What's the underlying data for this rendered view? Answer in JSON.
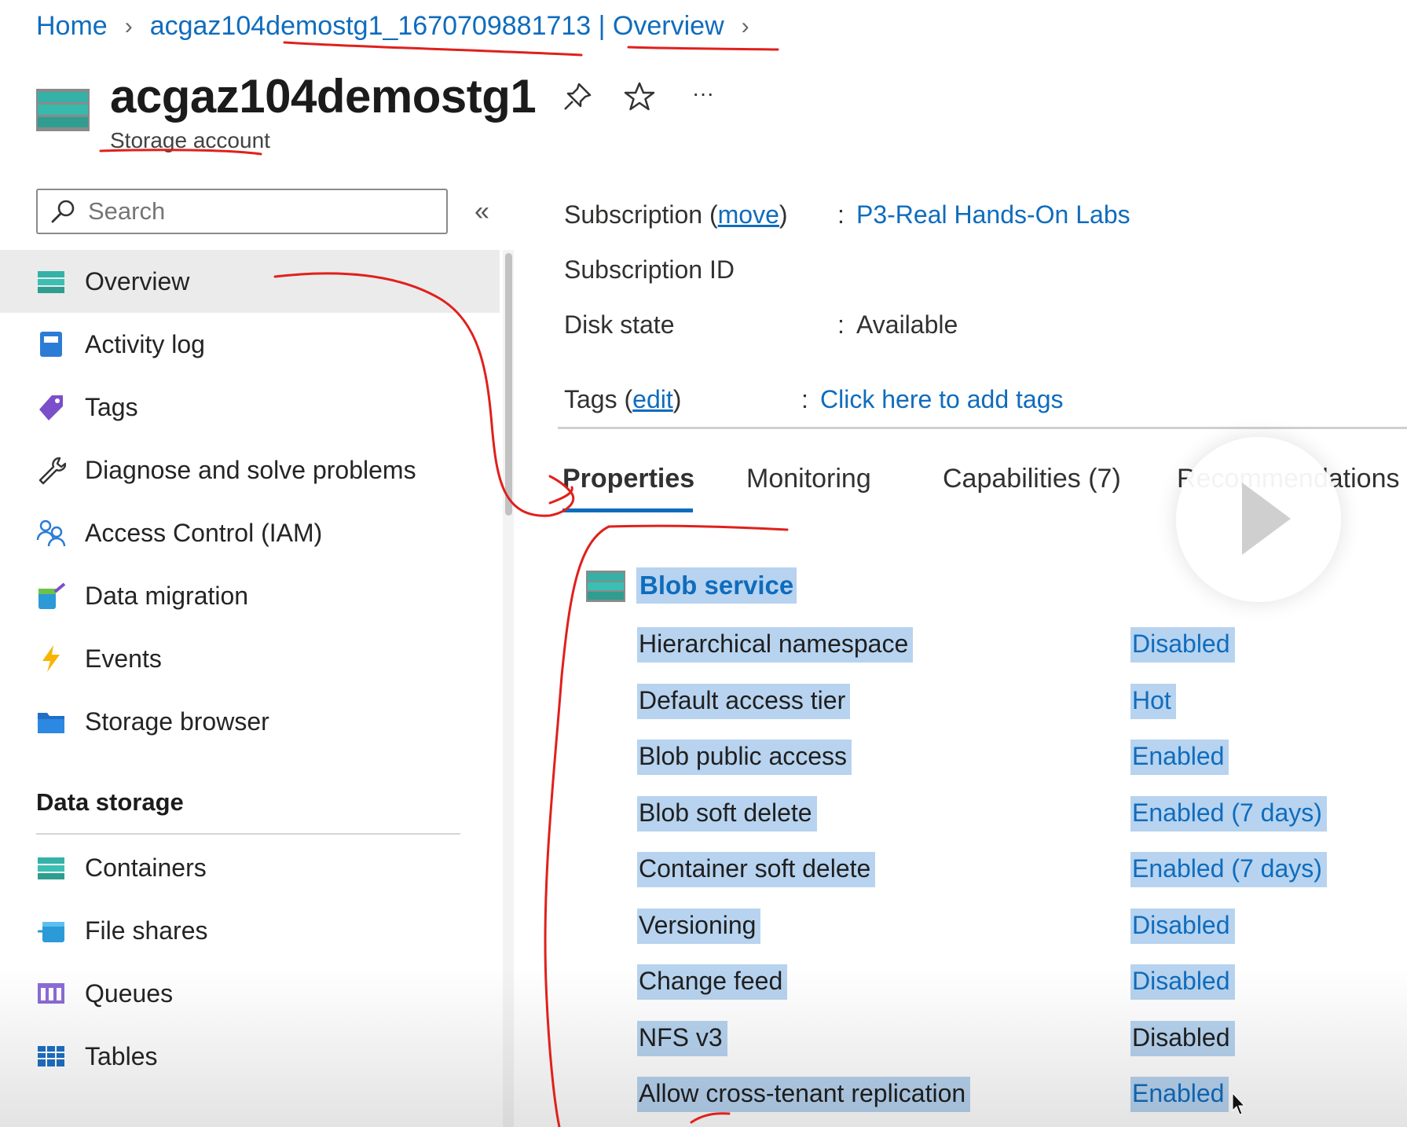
{
  "breadcrumb": {
    "home": "Home",
    "resource": "acgaz104demostg1_1670709881713 | Overview",
    "separator": ">"
  },
  "header": {
    "title": "acgaz104demostg1",
    "subtitle": "Storage account",
    "more_label": "···"
  },
  "sidebar": {
    "search_placeholder": "Search",
    "collapse_label": "«",
    "items": [
      {
        "label": "Overview",
        "icon": "storage-icon"
      },
      {
        "label": "Activity log",
        "icon": "activity-log-icon"
      },
      {
        "label": "Tags",
        "icon": "tag-icon"
      },
      {
        "label": "Diagnose and solve problems",
        "icon": "wrench-icon"
      },
      {
        "label": "Access Control (IAM)",
        "icon": "people-icon"
      },
      {
        "label": "Data migration",
        "icon": "data-migration-icon"
      },
      {
        "label": "Events",
        "icon": "lightning-icon"
      },
      {
        "label": "Storage browser",
        "icon": "folder-icon"
      }
    ],
    "section_data_storage": "Data storage",
    "data_storage_items": [
      {
        "label": "Containers",
        "icon": "containers-icon"
      },
      {
        "label": "File shares",
        "icon": "file-shares-icon"
      },
      {
        "label": "Queues",
        "icon": "queues-icon"
      },
      {
        "label": "Tables",
        "icon": "tables-icon"
      }
    ]
  },
  "essentials": {
    "subscription_label_pre": "Subscription (",
    "subscription_move": "move",
    "subscription_label_post": ")",
    "subscription_value": "P3-Real Hands-On Labs",
    "subscription_id_label": "Subscription ID",
    "disk_state_label": "Disk state",
    "disk_state_value": "Available",
    "tags_label_pre": "Tags (",
    "tags_edit": "edit",
    "tags_label_post": ")",
    "tags_value": "Click here to add tags",
    "colon": ":"
  },
  "tabs": [
    {
      "label": "Properties",
      "active": true
    },
    {
      "label": "Monitoring",
      "active": false
    },
    {
      "label": "Capabilities (7)",
      "active": false
    },
    {
      "label": "Recommendations",
      "active": false
    }
  ],
  "blob_service": {
    "title": "Blob service",
    "properties": [
      {
        "label": "Hierarchical namespace",
        "value": "Disabled",
        "link": true
      },
      {
        "label": "Default access tier",
        "value": "Hot",
        "link": true
      },
      {
        "label": "Blob public access",
        "value": "Enabled",
        "link": true
      },
      {
        "label": "Blob soft delete",
        "value": "Enabled (7 days)",
        "link": true
      },
      {
        "label": "Container soft delete",
        "value": "Enabled (7 days)",
        "link": true
      },
      {
        "label": "Versioning",
        "value": "Disabled",
        "link": true
      },
      {
        "label": "Change feed",
        "value": "Disabled",
        "link": true
      },
      {
        "label": "NFS v3",
        "value": "Disabled",
        "link": false
      },
      {
        "label": "Allow cross-tenant replication",
        "value": "Enabled",
        "link": true
      }
    ]
  },
  "colors": {
    "accent": "#0f6cbd",
    "selection": "#b7d3ef",
    "annotation": "#e0201c"
  }
}
